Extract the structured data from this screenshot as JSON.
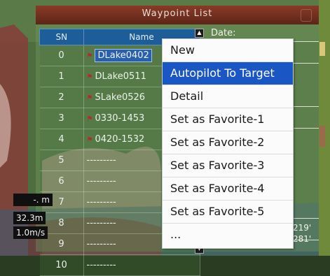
{
  "window": {
    "title": "Waypoint List"
  },
  "table": {
    "headers": {
      "sn": "SN",
      "name": "Name"
    },
    "rows": [
      {
        "sn": "0",
        "name": "DLake0402",
        "flag": true
      },
      {
        "sn": "1",
        "name": "DLake0511",
        "flag": true
      },
      {
        "sn": "2",
        "name": "SLake0526",
        "flag": true
      },
      {
        "sn": "3",
        "name": "0330-1453",
        "flag": true
      },
      {
        "sn": "4",
        "name": "0420-1532",
        "flag": true
      },
      {
        "sn": "5",
        "name": "---------",
        "flag": false
      },
      {
        "sn": "6",
        "name": "---------",
        "flag": false
      },
      {
        "sn": "7",
        "name": "---------",
        "flag": false
      },
      {
        "sn": "8",
        "name": "---------",
        "flag": false
      },
      {
        "sn": "9",
        "name": "---------",
        "flag": false
      },
      {
        "sn": "10",
        "name": "---------",
        "flag": false
      }
    ],
    "selected_index": 0
  },
  "detail": {
    "date_label": "Date:"
  },
  "context_menu": {
    "items": [
      "New",
      "Autopilot To Target",
      "Detail",
      "Set as Favorite-1",
      "Set as Favorite-2",
      "Set as Favorite-3",
      "Set as Favorite-4",
      "Set as Favorite-5",
      "..."
    ],
    "active_index": 1
  },
  "overlay": {
    "depth_main": "-. m",
    "depth_value": "32.3m",
    "speed": "1.0m/s",
    "right_value_1": "219'",
    "right_value_2": "281'"
  },
  "colors": {
    "title_bar": "#6e2c1c",
    "header": "#1d5d9a",
    "menu_highlight": "#1a56c4",
    "flag": "#b52a2a"
  }
}
